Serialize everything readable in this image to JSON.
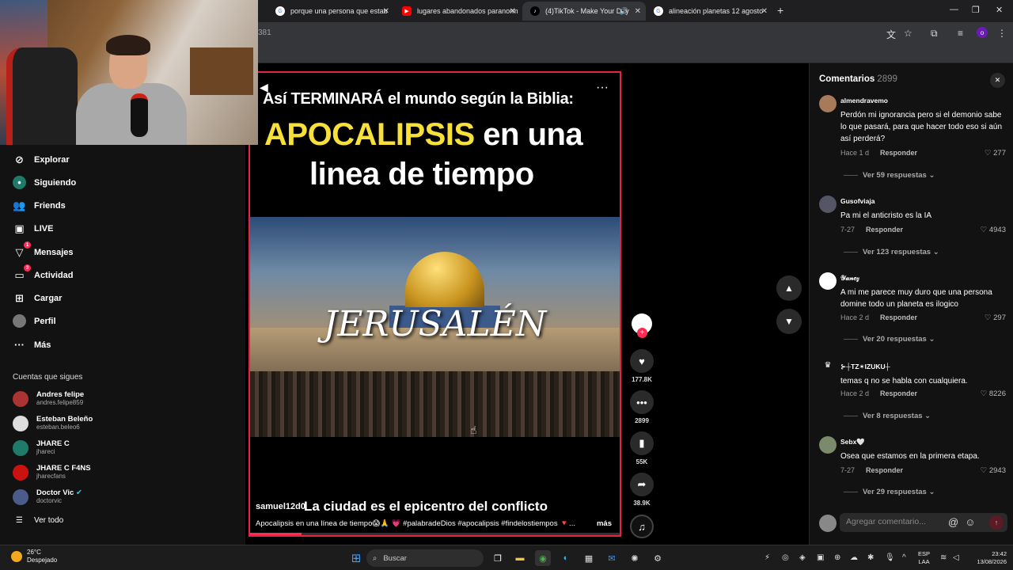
{
  "browser": {
    "tabs": [
      {
        "title": "porque una persona que estab",
        "icon": "google-icon"
      },
      {
        "title": "lugares abandonados paranorm",
        "icon": "youtube-icon"
      },
      {
        "title": "(4)TikTok - Make Your Day",
        "icon": "tiktok-icon"
      },
      {
        "title": "alineación planetas 12 agosto",
        "icon": "google-icon"
      }
    ],
    "url": "381"
  },
  "sidebar": {
    "nav": [
      {
        "label": "Explorar",
        "icon": "compass-icon",
        "badge": ""
      },
      {
        "label": "Siguiendo",
        "icon": "following-icon",
        "badge": ""
      },
      {
        "label": "Friends",
        "icon": "friends-icon",
        "badge": ""
      },
      {
        "label": "LIVE",
        "icon": "live-icon",
        "badge": ""
      },
      {
        "label": "Mensajes",
        "icon": "messages-icon",
        "badge": "1"
      },
      {
        "label": "Actividad",
        "icon": "activity-icon",
        "badge": "3"
      },
      {
        "label": "Cargar",
        "icon": "upload-icon",
        "badge": ""
      },
      {
        "label": "Perfil",
        "icon": "profile-icon",
        "badge": ""
      },
      {
        "label": "Más",
        "icon": "more-icon",
        "badge": ""
      }
    ],
    "following_title": "Cuentas que sigues",
    "accounts": [
      {
        "name": "Andres felipe",
        "handle": "andres.felipe859"
      },
      {
        "name": "Esteban Beleño",
        "handle": "esteban.beleo6"
      },
      {
        "name": "JHARE C",
        "handle": "jhareci"
      },
      {
        "name": "JHARE C F4NS",
        "handle": "jharecfans"
      },
      {
        "name": "Doctor Vic",
        "handle": "doctorvic"
      }
    ],
    "see_all": "Ver todo"
  },
  "video": {
    "title_line1": "Así TERMINARÁ el mundo según la Biblia:",
    "title_line2_highlight": "APOCALIPSIS",
    "title_line2_rest": " en una",
    "title_line3": "linea de tiempo",
    "image_caption": "JERUSALÉN",
    "username": "samuel12d0",
    "subtitle": "La ciudad es el epicentro del conflicto",
    "description": "Apocalipsis en una línea de tiempo😱🙏 💗 #palabradeDios #apocalipsis #findelostiempos 🔻...",
    "more": "más",
    "progress": 0.14
  },
  "actions": {
    "likes": "177.8K",
    "comments": "2899",
    "saves": "55K",
    "shares": "38.9K"
  },
  "comments_panel": {
    "title": "Comentarios",
    "count": "2899",
    "items": [
      {
        "user": "almendravemo",
        "text": "Perdón mi ignorancia pero si el demonio sabe lo que pasará, para que hacer todo eso si aún así perderá?",
        "time": "Hace 1 d",
        "reply": "Responder",
        "likes": "277",
        "replies": "Ver 59 respuestas"
      },
      {
        "user": "Gusofviaja",
        "text": "Pa mi el anticristo es la IA",
        "time": "7-27",
        "reply": "Responder",
        "likes": "4943",
        "replies": "Ver 123 respuestas"
      },
      {
        "user": "𝒴𝒶𝓃𝑒𝓏",
        "text": "A mi me parece muy duro que una persona domine todo un planeta es ilogico",
        "time": "Hace 2 d",
        "reply": "Responder",
        "likes": "297",
        "replies": "Ver 20 respuestas"
      },
      {
        "user": "⊱┼ΤΖ✶ΙΖUKU┼",
        "text": "temas q no se habla con cualquiera.",
        "time": "Hace 2 d",
        "reply": "Responder",
        "likes": "8226",
        "replies": "Ver 8 respuestas"
      },
      {
        "user": "Sebx🤍",
        "text": "Osea que estamos en la primera etapa.",
        "time": "7-27",
        "reply": "Responder",
        "likes": "2943",
        "replies": "Ver 29 respuestas"
      }
    ],
    "input_placeholder": "Agregar comentario..."
  },
  "taskbar": {
    "temp": "26°C",
    "weather": "Despejado",
    "search": "Buscar",
    "lang1": "ESP",
    "lang2": "LAA",
    "time": "23:42",
    "date": "13/08/2026"
  },
  "colors": {
    "accent": "#fe2c55",
    "highlight": "#f7e03a"
  }
}
